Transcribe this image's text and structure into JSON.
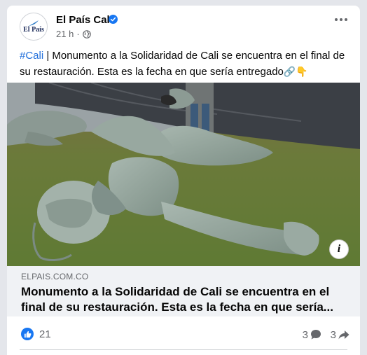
{
  "post": {
    "page_name": "El País Cali",
    "avatar_text": "El País",
    "time": "21 h",
    "separator": "·",
    "hashtag": "#Cali",
    "text": " | Monumento a la Solidaridad de Cali se encuentra en el final de su restauración. Esta es la fecha en que sería entregado",
    "emojis": "🔗👇",
    "icons": [
      "verified-badge-icon",
      "globe-icon",
      "more-options-icon",
      "info-icon",
      "like-icon",
      "comment-icon",
      "share-icon"
    ]
  },
  "link": {
    "domain": "ELPAIS.COM.CO",
    "title": "Monumento a la Solidaridad de Cali se encuentra en el final de su restauración. Esta es la fecha en que sería...",
    "info_label": "i"
  },
  "stats": {
    "likes": "21",
    "comments": "3",
    "shares": "3"
  },
  "colors": {
    "accent": "#1877f2",
    "hashtag": "#216fdb",
    "caption_bg": "#f0f2f5"
  }
}
